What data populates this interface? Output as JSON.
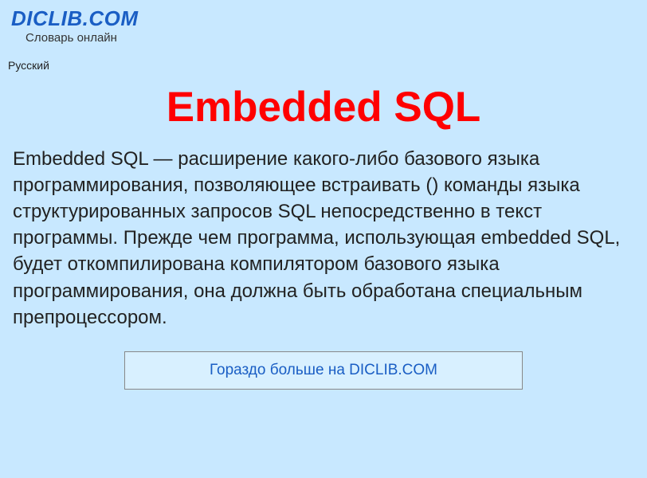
{
  "header": {
    "site_title": "DICLIB.COM",
    "site_subtitle": "Словарь онлайн"
  },
  "language_label": "Русский",
  "main": {
    "title": "Embedded SQL",
    "body": "Embedded SQL — расширение какого-либо базового языка программирования, позволяющее встраивать () команды языка структурированных запросов SQL непосредственно в текст программы. Прежде чем программа, использующая embedded SQL, будет откомпилирована компилятором базового языка программирования, она должна быть обработана специальным препроцессором."
  },
  "cta": {
    "label": "Гораздо больше на DICLIB.COM"
  }
}
